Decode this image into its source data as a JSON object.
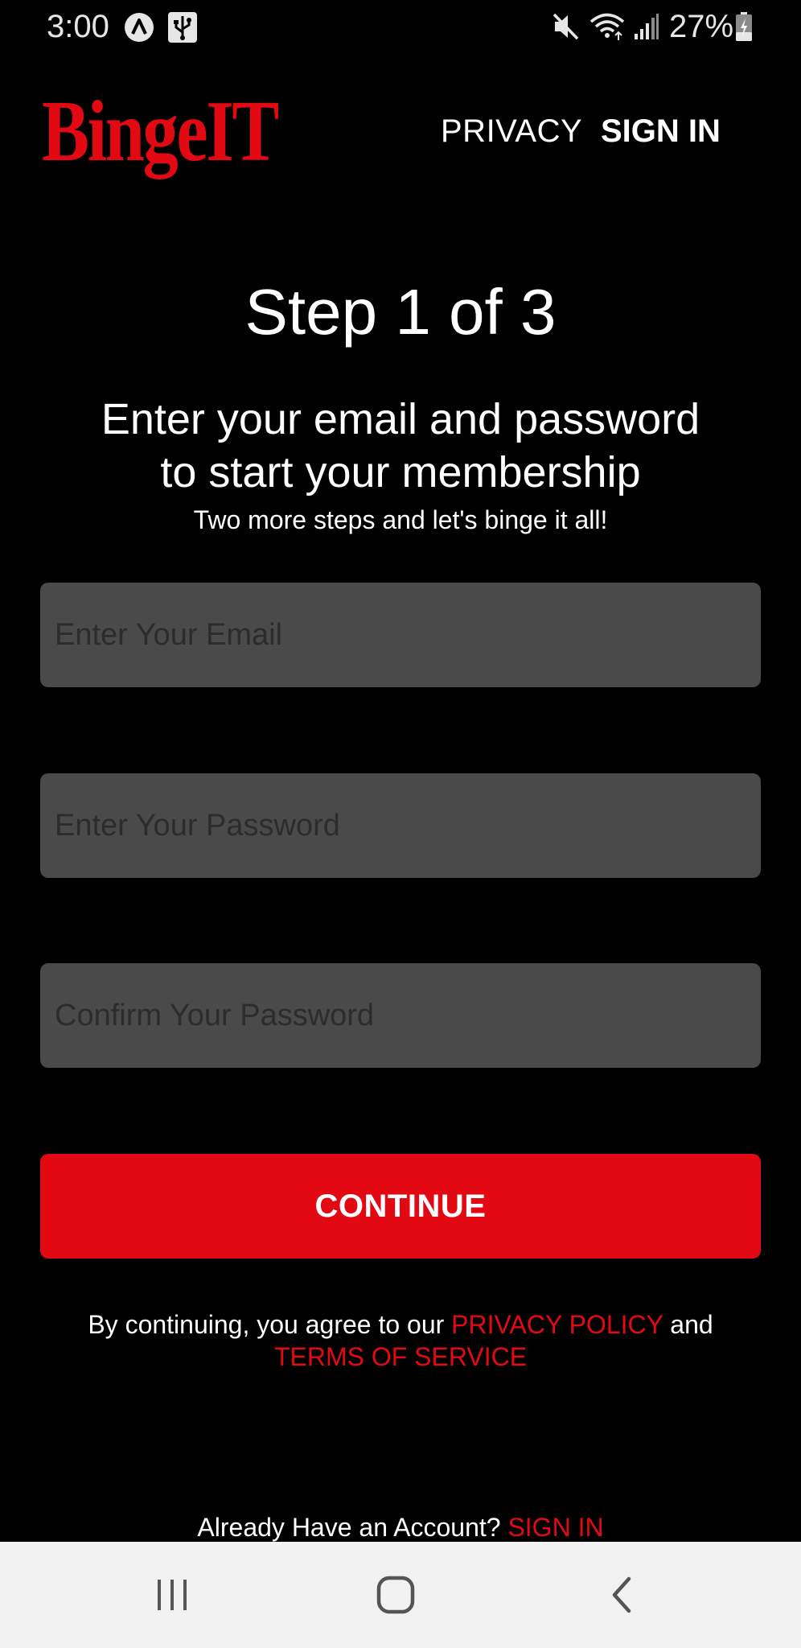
{
  "status_bar": {
    "time": "3:00",
    "battery": "27%",
    "icons": [
      "app-a-icon",
      "usb-icon",
      "mute-icon",
      "wifi-icon",
      "signal-icon",
      "battery-icon"
    ]
  },
  "header": {
    "logo": "BingeIT",
    "privacy_label": "PRIVACY",
    "signin_label": "SIGN IN"
  },
  "main": {
    "step_title": "Step 1 of 3",
    "headline_line1": "Enter your email and password",
    "headline_line2": "to start your membership",
    "subline": "Two more steps and let's binge it all!",
    "email_placeholder": "Enter Your Email",
    "password_placeholder": "Enter Your Password",
    "confirm_placeholder": "Confirm Your Password",
    "continue_label": "CONTINUE"
  },
  "legal": {
    "prefix": "By continuing, you agree to our ",
    "privacy_link": "PRIVACY POLICY",
    "and": " and",
    "terms_link": "TERMS OF SERVICE"
  },
  "footer": {
    "already_text": "Already Have an Account? ",
    "signin_link": "SIGN IN"
  },
  "nav_bar": {
    "icons": [
      "recent-apps-icon",
      "home-icon",
      "back-icon"
    ]
  },
  "colors": {
    "accent": "#e30913",
    "background": "#000000",
    "field": "#4a4a4a"
  }
}
